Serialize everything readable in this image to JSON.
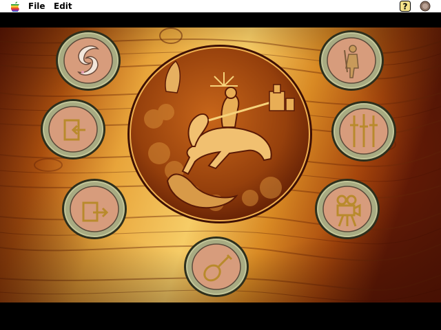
{
  "menubar": {
    "apple_icon": "apple-rainbow-icon",
    "items": [
      {
        "label": "File"
      },
      {
        "label": "Edit"
      }
    ],
    "help_icon": "help-question-icon",
    "app_icon": "app-switcher-icon"
  },
  "scene": {
    "background": "carved-wooden-panel",
    "centerpiece": "knight-on-horseback-relief",
    "buttons": [
      {
        "id": "dolphins",
        "icon": "dolphins-icon"
      },
      {
        "id": "enter",
        "icon": "enter-door-icon"
      },
      {
        "id": "exit",
        "icon": "exit-door-icon"
      },
      {
        "id": "lute",
        "icon": "lute-icon"
      },
      {
        "id": "knight-statue",
        "icon": "knight-statue-icon"
      },
      {
        "id": "swords",
        "icon": "swords-icon"
      },
      {
        "id": "movie-camera",
        "icon": "movie-camera-icon"
      }
    ]
  },
  "colors": {
    "wood_dark": "#5a1a06",
    "wood_mid": "#a8520f",
    "wood_light": "#f3c25a",
    "rim_dark": "#2e2f1c",
    "rim_light": "#c4c79a",
    "disc": "#d79c7c",
    "icon_gold": "#b98a2c"
  }
}
